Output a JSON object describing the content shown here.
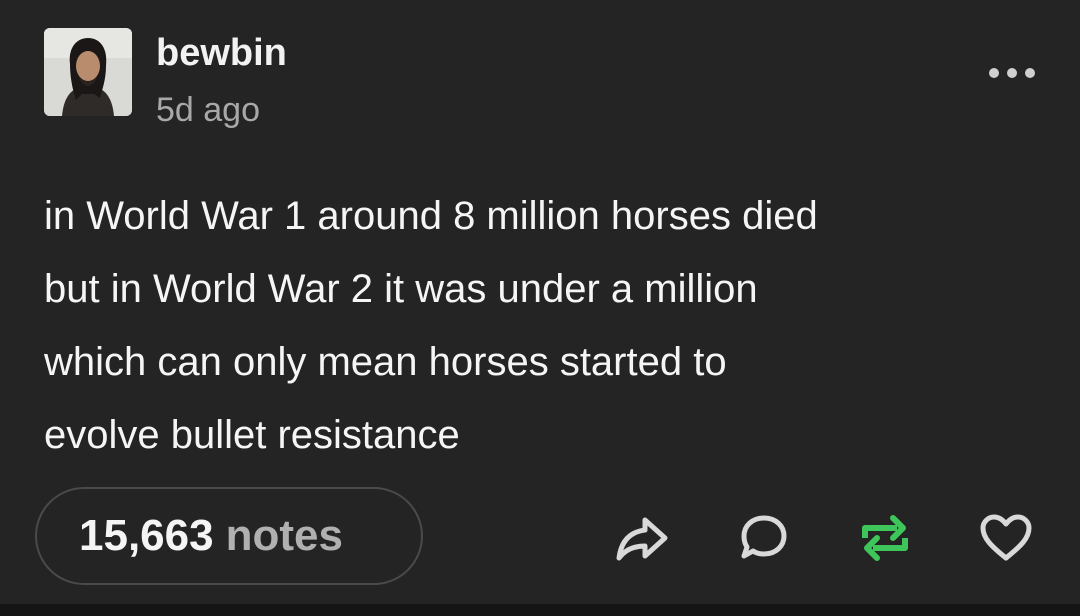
{
  "post": {
    "username": "bewbin",
    "timestamp": "5d ago",
    "body": "in World War 1 around 8 million horses died\nbut in World War 2 it was under a million\nwhich can only mean horses started to\nevolve bullet resistance",
    "notes_count": "15,663",
    "notes_label": "notes"
  },
  "icons": {
    "more": "more-horizontal-icon",
    "share": "share-icon",
    "reply": "reply-icon",
    "reblog": "reblog-icon",
    "like": "heart-icon"
  },
  "colors": {
    "background": "#242424",
    "reblog_accent": "#3ec65a"
  }
}
